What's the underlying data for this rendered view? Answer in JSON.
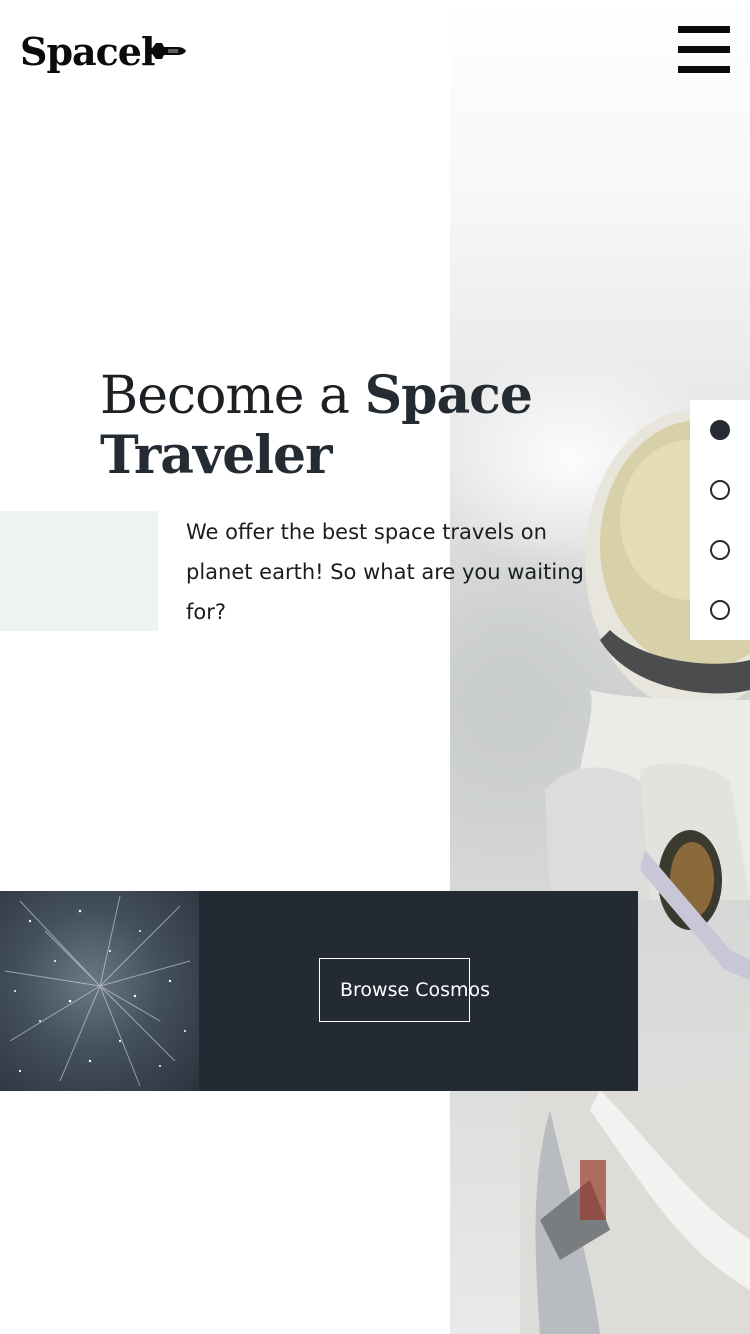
{
  "header": {
    "logo_text": "Spacel",
    "logo_icon": "space-shuttle-icon",
    "menu_icon": "hamburger-menu-icon"
  },
  "hero": {
    "title_light": "Become a ",
    "title_bold_1": "Space",
    "title_bold_2": "Traveler",
    "intro": "We offer the best space travels on planet earth! So what are you waiting for?",
    "image": "astronaut-photo"
  },
  "slider": {
    "total": 4,
    "active_index": 0
  },
  "cta": {
    "button_label": "Browse Cosmos",
    "image": "star-field-photo"
  },
  "colors": {
    "dark": "#232a33",
    "accent_block": "#eef2f2",
    "text": "#1a1d21"
  }
}
